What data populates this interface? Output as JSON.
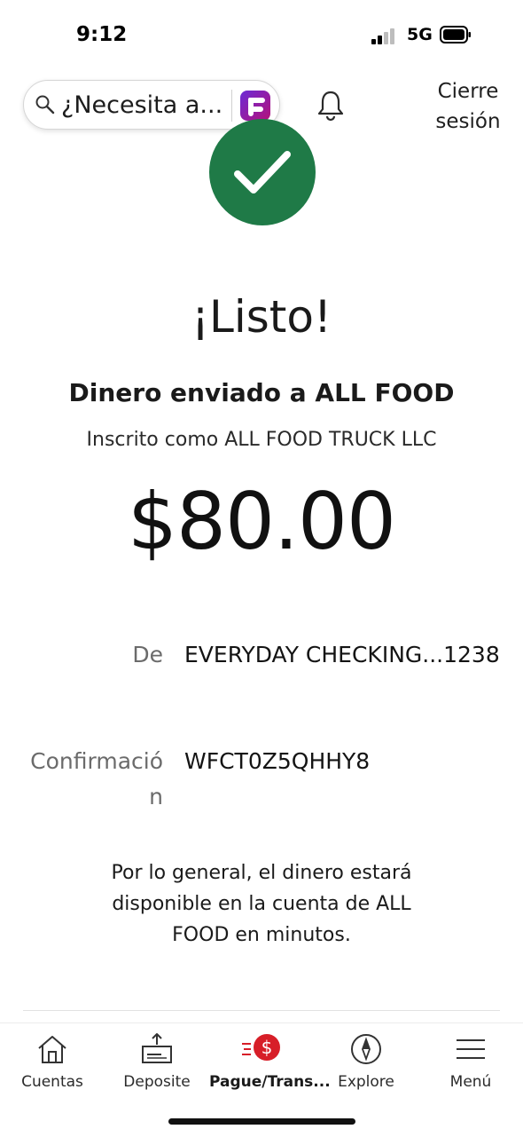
{
  "status_bar": {
    "time": "9:12",
    "network": "5G"
  },
  "header": {
    "search_placeholder": "¿Necesita a...",
    "logout_label": "Cierre sesión"
  },
  "success": {
    "headline": "¡Listo!",
    "subhead": "Dinero enviado a ALL FOOD",
    "enrolled": "Inscrito como ALL FOOD TRUCK LLC",
    "amount": "$80.00"
  },
  "details": {
    "from_label": "De",
    "from_value": "EVERYDAY CHECKING...1238",
    "confirmation_label": "Confirmación",
    "confirmation_value": "WFCT0Z5QHHY8"
  },
  "note": "Por lo general, el dinero estará disponible en la cuenta de ALL FOOD en minutos.",
  "tabbar": {
    "items": [
      {
        "label": "Cuentas",
        "icon": "home-icon"
      },
      {
        "label": "Deposite",
        "icon": "deposit-icon"
      },
      {
        "label": "Pague/Trans...",
        "icon": "pay-transfer-icon",
        "active": true
      },
      {
        "label": "Explore",
        "icon": "compass-icon"
      },
      {
        "label": "Menú",
        "icon": "menu-icon"
      }
    ]
  },
  "colors": {
    "success_green": "#1f7a47",
    "accent_red": "#d71e28"
  }
}
